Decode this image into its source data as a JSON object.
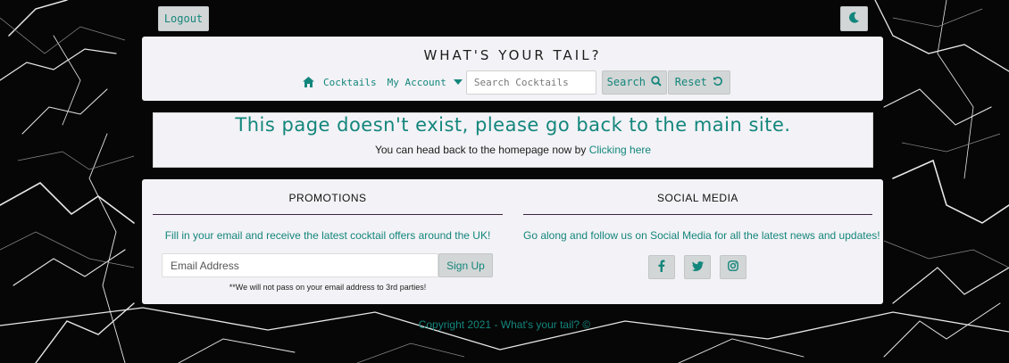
{
  "top_bar": {
    "logout_label": "Logout"
  },
  "header": {
    "title": "WHAT'S YOUR TAIL?",
    "nav": {
      "cocktails_label": "Cocktails",
      "account_label": "My Account",
      "search_placeholder": "Search Cocktails",
      "search_label": "Search",
      "reset_label": "Reset"
    }
  },
  "notice": {
    "heading": "This page doesn't exist, please go back to the main site.",
    "text": "You can head back to the homepage now by",
    "link_label": "Clicking here"
  },
  "footer": {
    "promotions": {
      "title": "PROMOTIONS",
      "text": "Fill in your email and receive the latest cocktail offers around the UK!",
      "email_placeholder": "Email Address",
      "signup_label": "Sign Up",
      "note": "**We will not pass on your email address to 3rd parties!"
    },
    "social": {
      "title": "SOCIAL MEDIA",
      "text": "Go along and follow us on Social Media for all the latest news and updates!",
      "icons": [
        "facebook-icon",
        "twitter-icon",
        "instagram-icon"
      ]
    },
    "copyright": "Copyright 2021 - What's your tail? ©"
  },
  "colors": {
    "accent": "#13867c",
    "card_bg": "#f3f2f6",
    "button_bg": "#d3d6d6",
    "background": "#050505"
  }
}
